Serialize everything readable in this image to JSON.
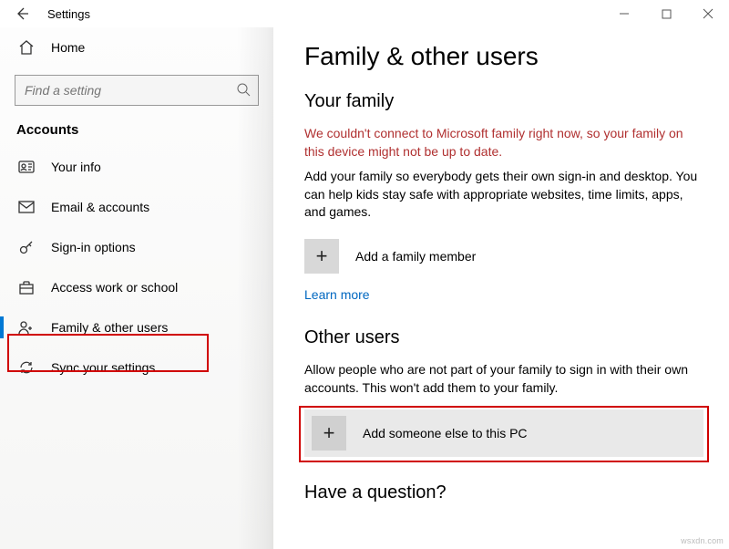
{
  "titlebar": {
    "title": "Settings"
  },
  "sidebar": {
    "home": "Home",
    "search_placeholder": "Find a setting",
    "category": "Accounts",
    "items": [
      {
        "label": "Your info"
      },
      {
        "label": "Email & accounts"
      },
      {
        "label": "Sign-in options"
      },
      {
        "label": "Access work or school"
      },
      {
        "label": "Family & other users"
      },
      {
        "label": "Sync your settings"
      }
    ]
  },
  "content": {
    "page_title": "Family & other users",
    "family": {
      "heading": "Your family",
      "error": "We couldn't connect to Microsoft family right now, so your family on this device might not be up to date.",
      "desc": "Add your family so everybody gets their own sign-in and desktop. You can help kids stay safe with appropriate websites, time limits, apps, and games.",
      "add_label": "Add a family member",
      "learn_more": "Learn more"
    },
    "other": {
      "heading": "Other users",
      "desc": "Allow people who are not part of your family to sign in with their own accounts. This won't add them to your family.",
      "add_label": "Add someone else to this PC"
    },
    "question": "Have a question?"
  },
  "watermark": "wsxdn.com"
}
